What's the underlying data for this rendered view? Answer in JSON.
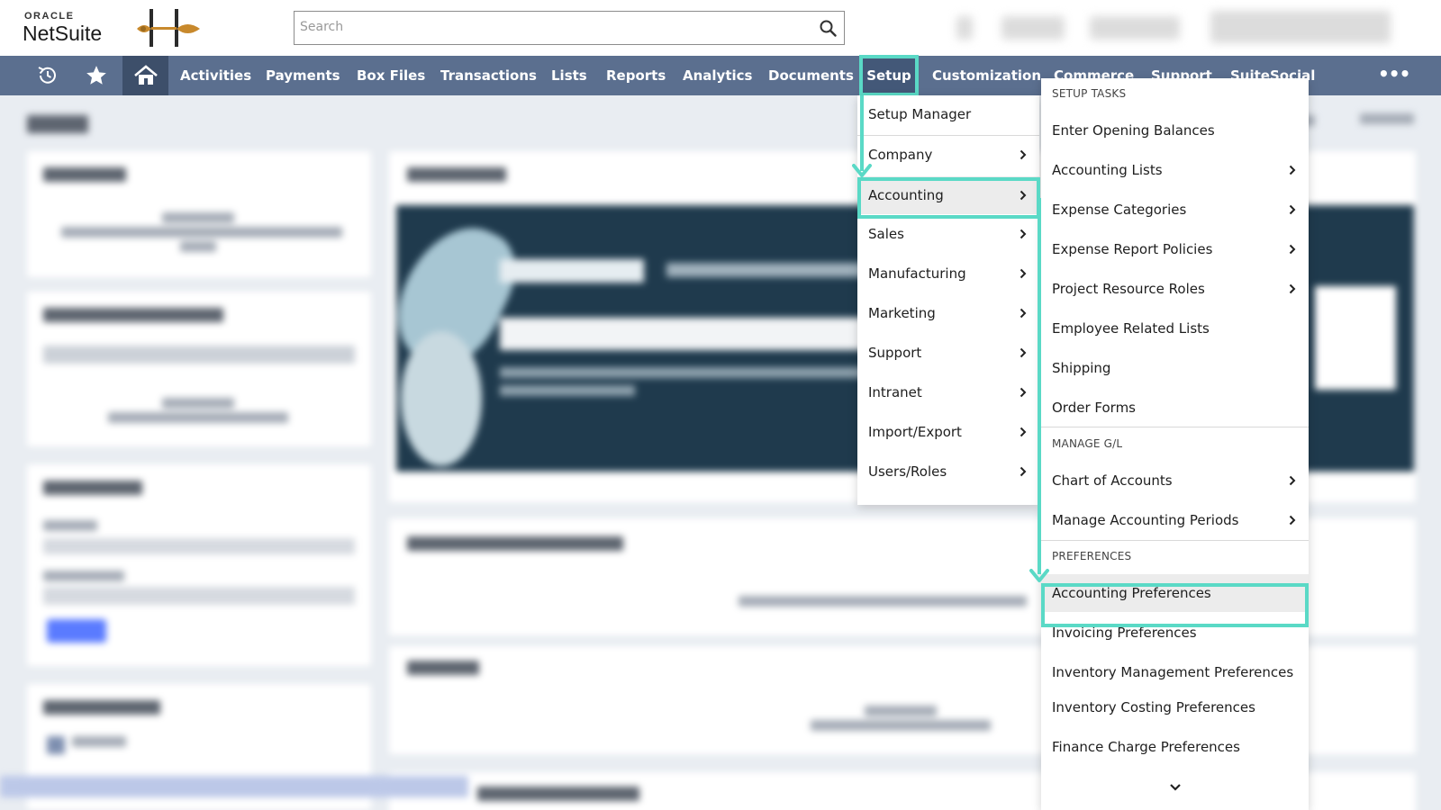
{
  "header": {
    "logo_top": "ORACLE",
    "logo_main": "NetSuite",
    "search_placeholder": "Search"
  },
  "nav": {
    "items": [
      "Activities",
      "Payments",
      "Box Files",
      "Transactions",
      "Lists",
      "Reports",
      "Analytics",
      "Documents",
      "Setup",
      "Customization",
      "Commerce",
      "Support",
      "SuiteSocial"
    ],
    "more_label": "•••",
    "active": "Setup"
  },
  "setup_menu": {
    "items": [
      {
        "label": "Setup Manager",
        "submenu": false
      },
      {
        "label": "Company",
        "submenu": true
      },
      {
        "label": "Accounting",
        "submenu": true,
        "selected": true
      },
      {
        "label": "Sales",
        "submenu": true
      },
      {
        "label": "Manufacturing",
        "submenu": true
      },
      {
        "label": "Marketing",
        "submenu": true
      },
      {
        "label": "Support",
        "submenu": true
      },
      {
        "label": "Intranet",
        "submenu": true
      },
      {
        "label": "Import/Export",
        "submenu": true
      },
      {
        "label": "Users/Roles",
        "submenu": true
      }
    ]
  },
  "accounting_menu": {
    "sections": [
      {
        "title": "SETUP TASKS",
        "items": [
          {
            "label": "Enter Opening Balances",
            "submenu": false
          },
          {
            "label": "Accounting Lists",
            "submenu": true
          },
          {
            "label": "Expense Categories",
            "submenu": true
          },
          {
            "label": "Expense Report Policies",
            "submenu": true
          },
          {
            "label": "Project Resource Roles",
            "submenu": true
          },
          {
            "label": "Employee Related Lists",
            "submenu": false
          },
          {
            "label": "Shipping",
            "submenu": false
          },
          {
            "label": "Order Forms",
            "submenu": false
          }
        ]
      },
      {
        "title": "MANAGE G/L",
        "items": [
          {
            "label": "Chart of Accounts",
            "submenu": true
          },
          {
            "label": "Manage Accounting Periods",
            "submenu": true
          }
        ]
      },
      {
        "title": "PREFERENCES",
        "items": [
          {
            "label": "Accounting Preferences",
            "submenu": false,
            "selected": true
          },
          {
            "label": "Invoicing Preferences",
            "submenu": false
          },
          {
            "label": "Inventory Management Preferences",
            "submenu": false
          },
          {
            "label": "Inventory Costing Preferences",
            "submenu": false
          },
          {
            "label": "Finance Charge Preferences",
            "submenu": false
          }
        ]
      }
    ]
  },
  "colors": {
    "highlight": "#5ad9c6",
    "navbar": "#5b6f8f",
    "nav_active": "#3d4f6a"
  },
  "icons": [
    "history-icon",
    "star-icon",
    "home-icon",
    "search-icon",
    "chevron-right-icon",
    "chevron-down-icon",
    "brand-logo-icon"
  ]
}
